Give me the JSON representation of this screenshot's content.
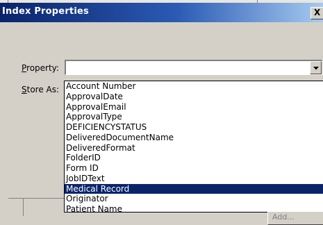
{
  "window": {
    "title": "Index Properties",
    "close_glyph": "X"
  },
  "form": {
    "property_label": "Property:",
    "property_label_mnemonic": "P",
    "property_label_rest": "roperty:",
    "store_as_label": "Store As:",
    "store_as_label_mnemonic": "S",
    "store_as_label_rest": "tore As:",
    "property_value": ""
  },
  "dropdown": {
    "items": [
      "Account Number",
      "ApprovalDate",
      "ApprovalEmail",
      "ApprovalType",
      "DEFICIENCYSTATUS",
      "DeliveredDocumentName",
      "DeliveredFormat",
      "FolderID",
      "Form ID",
      "JobIDText",
      "Medical Record",
      "Originator",
      "Patient Name"
    ],
    "selected_index": 10,
    "selected_item": "Medical Record"
  },
  "background": {
    "partial_button_label": "Add..."
  },
  "colors": {
    "title_bar": "#0a246a",
    "selection": "#0a246a",
    "dialog_face": "#d4d0c8"
  },
  "icons": {
    "combo_arrow": "chevron-down-icon",
    "close": "close-icon"
  }
}
